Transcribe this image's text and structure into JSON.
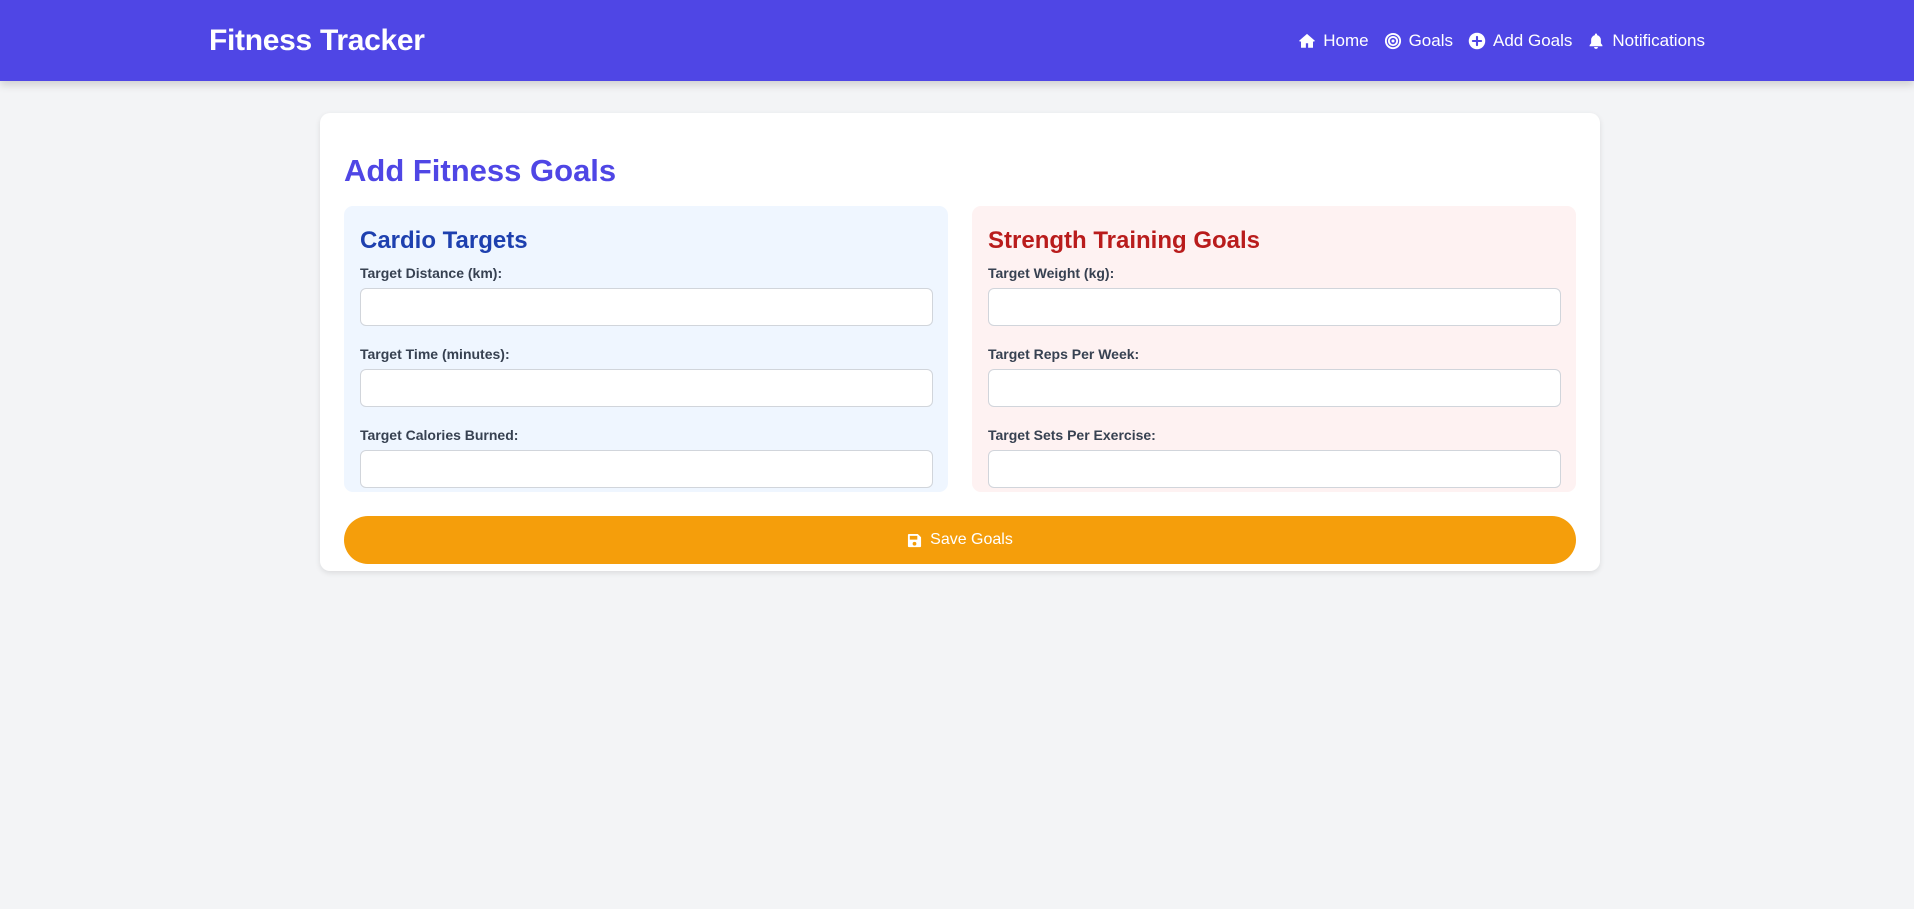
{
  "navbar": {
    "brand": "Fitness Tracker",
    "links": [
      {
        "label": "Home",
        "icon": "home-icon"
      },
      {
        "label": "Goals",
        "icon": "bullseye-icon"
      },
      {
        "label": "Add Goals",
        "icon": "plus-circle-icon"
      },
      {
        "label": "Notifications",
        "icon": "bell-icon"
      }
    ]
  },
  "page": {
    "title": "Add Fitness Goals"
  },
  "cardio": {
    "title": "Cardio Targets",
    "fields": [
      {
        "label": "Target Distance (km):",
        "value": "",
        "placeholder": ""
      },
      {
        "label": "Target Time (minutes):",
        "value": "",
        "placeholder": ""
      },
      {
        "label": "Target Calories Burned:",
        "value": "",
        "placeholder": ""
      }
    ]
  },
  "strength": {
    "title": "Strength Training Goals",
    "fields": [
      {
        "label": "Target Weight (kg):",
        "value": "",
        "placeholder": ""
      },
      {
        "label": "Target Reps Per Week:",
        "value": "",
        "placeholder": ""
      },
      {
        "label": "Target Sets Per Exercise:",
        "value": "",
        "placeholder": ""
      }
    ]
  },
  "save_button": {
    "label": "Save Goals",
    "icon": "save-icon"
  },
  "colors": {
    "navbar": "#4f46e5",
    "page_background": "#f3f4f6",
    "cardio_panel": "#eff6ff",
    "cardio_title": "#1e40af",
    "strength_panel": "#fef2f2",
    "strength_title": "#b91c1c",
    "save_button": "#f59e0b"
  }
}
